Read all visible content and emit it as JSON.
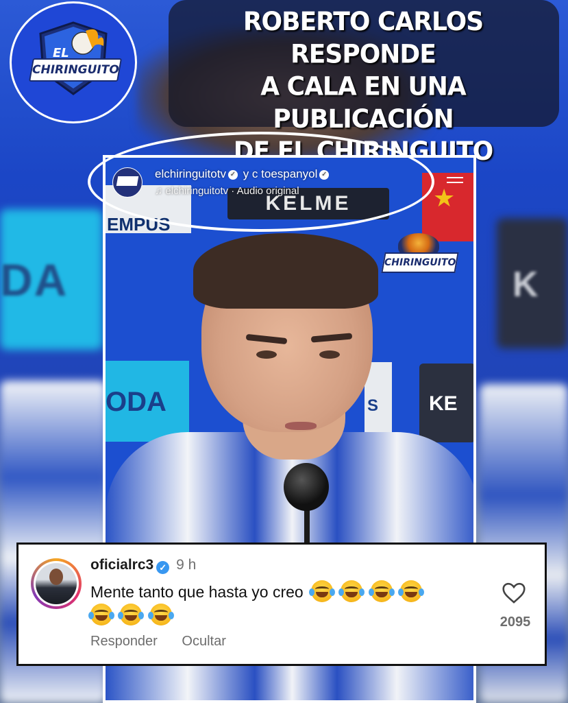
{
  "headline": {
    "line1": "ROBERTO CARLOS RESPONDE",
    "line2": "A CALA EN UNA PUBLICACIÓN",
    "line3": "DE EL CHIRINGUITO"
  },
  "logo": {
    "prefix": "EL",
    "name": "CHIRINGUITO"
  },
  "post": {
    "username": "elchiringuitotv",
    "collab_joiner": "y",
    "collab_user_partial": "c        toespanyol",
    "audio_label": "elchiringuitotv · Audio original",
    "sponsor_left": "EMPUS",
    "sponsor_kelme": "KELME",
    "sponsor_cyan": "ODA",
    "sponsor_mid": "S",
    "sponsor_right": "KE",
    "watermark_logo": "CHIRINGUITO"
  },
  "comment": {
    "username": "oficialrc3",
    "time": "9 h",
    "text": "Mente tanto que hasta yo creo",
    "emoji_count_line1": 4,
    "emoji_count_line2": 3,
    "emoji_name": "face-with-tears-of-joy",
    "reply_label": "Responder",
    "hide_label": "Ocultar",
    "like_count": "2095"
  },
  "colors": {
    "brand_blue": "#1f47d6",
    "verified_blue": "#3897f0",
    "comment_bg": "#ffffff"
  }
}
